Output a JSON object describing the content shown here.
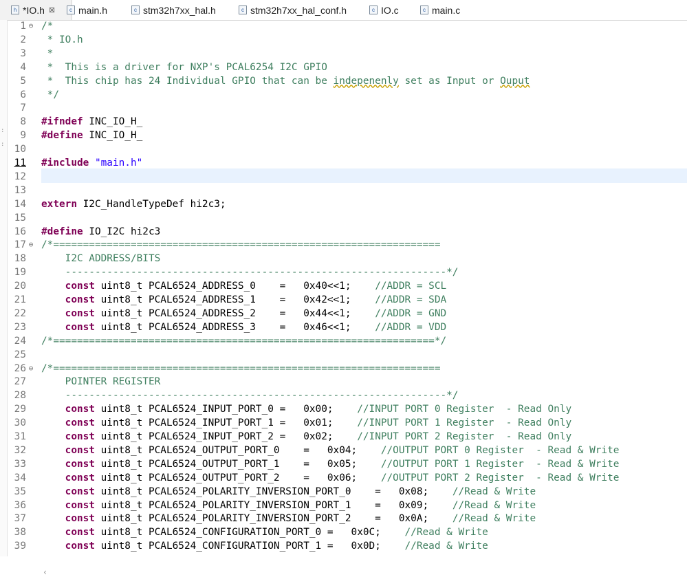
{
  "tabs": [
    {
      "label": "*IO.h",
      "icon": "h",
      "close": "⊠"
    },
    {
      "label": "main.h",
      "icon": "c"
    },
    {
      "label": "stm32h7xx_hal.h",
      "icon": "c"
    },
    {
      "label": "stm32h7xx_hal_conf.h",
      "icon": "c"
    },
    {
      "label": "IO.c",
      "icon": "c"
    },
    {
      "label": "main.c",
      "icon": "c"
    }
  ],
  "lines": [
    {
      "n": "1",
      "fold": "⊖",
      "segs": [
        {
          "t": "/*",
          "c": "cm"
        }
      ]
    },
    {
      "n": "2",
      "segs": [
        {
          "t": " * IO.h",
          "c": "cm"
        }
      ]
    },
    {
      "n": "3",
      "segs": [
        {
          "t": " *",
          "c": "cm"
        }
      ]
    },
    {
      "n": "4",
      "segs": [
        {
          "t": " *  This is a driver for NXP's PCAL6254 I2C GPIO",
          "c": "cm"
        }
      ]
    },
    {
      "n": "5",
      "segs": [
        {
          "t": " *  This chip has 24 Individual GPIO that can be ",
          "c": "cm"
        },
        {
          "t": "indepenenly",
          "c": "cm typo"
        },
        {
          "t": " set as Input or ",
          "c": "cm"
        },
        {
          "t": "Ouput",
          "c": "cm typo"
        }
      ]
    },
    {
      "n": "6",
      "segs": [
        {
          "t": " */",
          "c": "cm"
        }
      ]
    },
    {
      "n": "7",
      "segs": []
    },
    {
      "n": "8",
      "segs": [
        {
          "t": "#ifndef",
          "c": "pp"
        },
        {
          "t": " INC_IO_H_",
          "c": ""
        }
      ]
    },
    {
      "n": "9",
      "segs": [
        {
          "t": "#define",
          "c": "pp"
        },
        {
          "t": " INC_IO_H_",
          "c": ""
        }
      ]
    },
    {
      "n": "10",
      "segs": []
    },
    {
      "n": "11",
      "segs": [
        {
          "t": "#include",
          "c": "pp"
        },
        {
          "t": " ",
          "c": ""
        },
        {
          "t": "\"main.h\"",
          "c": "str"
        }
      ]
    },
    {
      "n": "12",
      "segs": []
    },
    {
      "n": "13",
      "segs": []
    },
    {
      "n": "14",
      "segs": [
        {
          "t": "extern",
          "c": "kw"
        },
        {
          "t": " I2C_HandleTypeDef hi2c3;",
          "c": ""
        }
      ]
    },
    {
      "n": "15",
      "segs": []
    },
    {
      "n": "16",
      "segs": [
        {
          "t": "#define",
          "c": "pp"
        },
        {
          "t": " IO_I2C hi2c3",
          "c": ""
        }
      ]
    },
    {
      "n": "17",
      "fold": "⊖",
      "segs": [
        {
          "t": "/*=================================================================",
          "c": "cm"
        }
      ]
    },
    {
      "n": "18",
      "segs": [
        {
          "t": "    I2C ADDRESS/BITS",
          "c": "cm"
        }
      ]
    },
    {
      "n": "19",
      "segs": [
        {
          "t": "    ----------------------------------------------------------------*/",
          "c": "cm"
        }
      ]
    },
    {
      "n": "20",
      "segs": [
        {
          "t": "    ",
          "c": ""
        },
        {
          "t": "const",
          "c": "kw"
        },
        {
          "t": " uint8_t PCAL6524_ADDRESS_0    =   0x40<<1;    ",
          "c": ""
        },
        {
          "t": "//ADDR = SCL",
          "c": "cm"
        }
      ]
    },
    {
      "n": "21",
      "segs": [
        {
          "t": "    ",
          "c": ""
        },
        {
          "t": "const",
          "c": "kw"
        },
        {
          "t": " uint8_t PCAL6524_ADDRESS_1    =   0x42<<1;    ",
          "c": ""
        },
        {
          "t": "//ADDR = SDA",
          "c": "cm"
        }
      ]
    },
    {
      "n": "22",
      "segs": [
        {
          "t": "    ",
          "c": ""
        },
        {
          "t": "const",
          "c": "kw"
        },
        {
          "t": " uint8_t PCAL6524_ADDRESS_2    =   0x44<<1;    ",
          "c": ""
        },
        {
          "t": "//ADDR = GND",
          "c": "cm"
        }
      ]
    },
    {
      "n": "23",
      "segs": [
        {
          "t": "    ",
          "c": ""
        },
        {
          "t": "const",
          "c": "kw"
        },
        {
          "t": " uint8_t PCAL6524_ADDRESS_3    =   0x46<<1;    ",
          "c": ""
        },
        {
          "t": "//ADDR = VDD",
          "c": "cm"
        }
      ]
    },
    {
      "n": "24",
      "segs": [
        {
          "t": "/*================================================================*/",
          "c": "cm"
        }
      ]
    },
    {
      "n": "25",
      "segs": []
    },
    {
      "n": "26",
      "fold": "⊖",
      "segs": [
        {
          "t": "/*=================================================================",
          "c": "cm"
        }
      ]
    },
    {
      "n": "27",
      "segs": [
        {
          "t": "    POINTER REGISTER",
          "c": "cm"
        }
      ]
    },
    {
      "n": "28",
      "segs": [
        {
          "t": "    ----------------------------------------------------------------*/",
          "c": "cm"
        }
      ]
    },
    {
      "n": "29",
      "segs": [
        {
          "t": "    ",
          "c": ""
        },
        {
          "t": "const",
          "c": "kw"
        },
        {
          "t": " uint8_t PCAL6524_INPUT_PORT_0 =   0x00;    ",
          "c": ""
        },
        {
          "t": "//INPUT PORT 0 Register  - Read Only",
          "c": "cm"
        }
      ]
    },
    {
      "n": "30",
      "segs": [
        {
          "t": "    ",
          "c": ""
        },
        {
          "t": "const",
          "c": "kw"
        },
        {
          "t": " uint8_t PCAL6524_INPUT_PORT_1 =   0x01;    ",
          "c": ""
        },
        {
          "t": "//INPUT PORT 1 Register  - Read Only",
          "c": "cm"
        }
      ]
    },
    {
      "n": "31",
      "segs": [
        {
          "t": "    ",
          "c": ""
        },
        {
          "t": "const",
          "c": "kw"
        },
        {
          "t": " uint8_t PCAL6524_INPUT_PORT_2 =   0x02;    ",
          "c": ""
        },
        {
          "t": "//INPUT PORT 2 Register  - Read Only",
          "c": "cm"
        }
      ]
    },
    {
      "n": "32",
      "segs": [
        {
          "t": "    ",
          "c": ""
        },
        {
          "t": "const",
          "c": "kw"
        },
        {
          "t": " uint8_t PCAL6524_OUTPUT_PORT_0    =   0x04;    ",
          "c": ""
        },
        {
          "t": "//OUTPUT PORT 0 Register  - Read & Write",
          "c": "cm"
        }
      ]
    },
    {
      "n": "33",
      "segs": [
        {
          "t": "    ",
          "c": ""
        },
        {
          "t": "const",
          "c": "kw"
        },
        {
          "t": " uint8_t PCAL6524_OUTPUT_PORT_1    =   0x05;    ",
          "c": ""
        },
        {
          "t": "//OUTPUT PORT 1 Register  - Read & Write",
          "c": "cm"
        }
      ]
    },
    {
      "n": "34",
      "segs": [
        {
          "t": "    ",
          "c": ""
        },
        {
          "t": "const",
          "c": "kw"
        },
        {
          "t": " uint8_t PCAL6524_OUTPUT_PORT_2    =   0x06;    ",
          "c": ""
        },
        {
          "t": "//OUTPUT PORT 2 Register  - Read & Write",
          "c": "cm"
        }
      ]
    },
    {
      "n": "35",
      "segs": [
        {
          "t": "    ",
          "c": ""
        },
        {
          "t": "const",
          "c": "kw"
        },
        {
          "t": " uint8_t PCAL6524_POLARITY_INVERSION_PORT_0    =   0x08;    ",
          "c": ""
        },
        {
          "t": "//Read & Write",
          "c": "cm"
        }
      ]
    },
    {
      "n": "36",
      "segs": [
        {
          "t": "    ",
          "c": ""
        },
        {
          "t": "const",
          "c": "kw"
        },
        {
          "t": " uint8_t PCAL6524_POLARITY_INVERSION_PORT_1    =   0x09;    ",
          "c": ""
        },
        {
          "t": "//Read & Write",
          "c": "cm"
        }
      ]
    },
    {
      "n": "37",
      "segs": [
        {
          "t": "    ",
          "c": ""
        },
        {
          "t": "const",
          "c": "kw"
        },
        {
          "t": " uint8_t PCAL6524_POLARITY_INVERSION_PORT_2    =   0x0A;    ",
          "c": ""
        },
        {
          "t": "//Read & Write",
          "c": "cm"
        }
      ]
    },
    {
      "n": "38",
      "segs": [
        {
          "t": "    ",
          "c": ""
        },
        {
          "t": "const",
          "c": "kw"
        },
        {
          "t": " uint8_t PCAL6524_CONFIGURATION_PORT_0 =   0x0C;    ",
          "c": ""
        },
        {
          "t": "//Read & Write",
          "c": "cm"
        }
      ]
    },
    {
      "n": "39",
      "segs": [
        {
          "t": "    ",
          "c": ""
        },
        {
          "t": "const",
          "c": "kw"
        },
        {
          "t": " uint8_t PCAL6524_CONFIGURATION_PORT_1 =   0x0D;    ",
          "c": ""
        },
        {
          "t": "//Read & Write",
          "c": "cm"
        }
      ]
    }
  ],
  "current_line": "11",
  "scroll_left_glyph": "‹"
}
